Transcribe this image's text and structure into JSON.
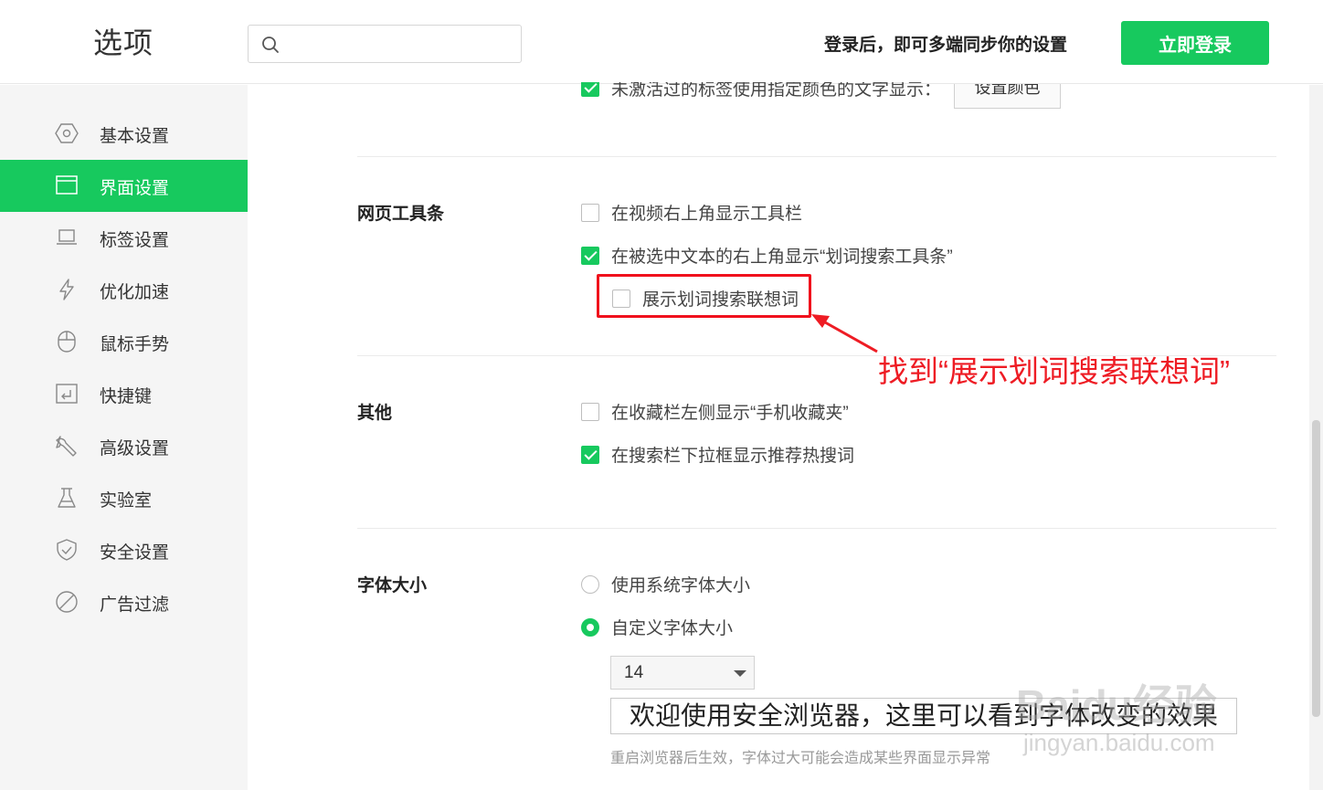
{
  "header": {
    "title": "选项",
    "search": {
      "value": "",
      "placeholder": ""
    },
    "sync_text": "登录后，即可多端同步你的设置",
    "login_button": "立即登录"
  },
  "sidebar": {
    "items": [
      {
        "label": "基本设置",
        "icon": "gear-hex-icon",
        "active": false
      },
      {
        "label": "界面设置",
        "icon": "window-icon",
        "active": true
      },
      {
        "label": "标签设置",
        "icon": "laptop-icon",
        "active": false
      },
      {
        "label": "优化加速",
        "icon": "lightning-icon",
        "active": false
      },
      {
        "label": "鼠标手势",
        "icon": "mouse-icon",
        "active": false
      },
      {
        "label": "快捷键",
        "icon": "keyboard-icon",
        "active": false
      },
      {
        "label": "高级设置",
        "icon": "wrench-icon",
        "active": false
      },
      {
        "label": "实验室",
        "icon": "flask-icon",
        "active": false
      },
      {
        "label": "安全设置",
        "icon": "shield-icon",
        "active": false
      },
      {
        "label": "广告过滤",
        "icon": "block-icon",
        "active": false
      }
    ]
  },
  "content": {
    "top_option": {
      "label": "未激活过的标签使用指定颜色的文字显示：",
      "checked": true,
      "button": "设置颜色"
    },
    "toolbar_section": {
      "title": "网页工具条",
      "options": [
        {
          "label": "在视频右上角显示工具栏",
          "checked": false
        },
        {
          "label": "在被选中文本的右上角显示“划词搜索工具条”",
          "checked": true
        },
        {
          "label": "展示划词搜索联想词",
          "checked": false
        }
      ]
    },
    "annotation": "找到“展示划词搜索联想词”",
    "other_section": {
      "title": "其他",
      "options": [
        {
          "label": "在收藏栏左侧显示“手机收藏夹”",
          "checked": false
        },
        {
          "label": "在搜索栏下拉框显示推荐热搜词",
          "checked": true
        }
      ]
    },
    "font_section": {
      "title": "字体大小",
      "options": [
        {
          "label": "使用系统字体大小",
          "checked": false
        },
        {
          "label": "自定义字体大小",
          "checked": true
        }
      ],
      "size_value": "14",
      "preview_text": "欢迎使用安全浏览器，这里可以看到字体改变的效果",
      "note": "重启浏览器后生效，字体过大可能会造成某些界面显示异常"
    }
  },
  "watermark": {
    "brand": "Baidu经验",
    "url": "jingyan.baidu.com"
  },
  "colors": {
    "accent": "#17c95e",
    "annotation_red": "#ee1c24"
  }
}
